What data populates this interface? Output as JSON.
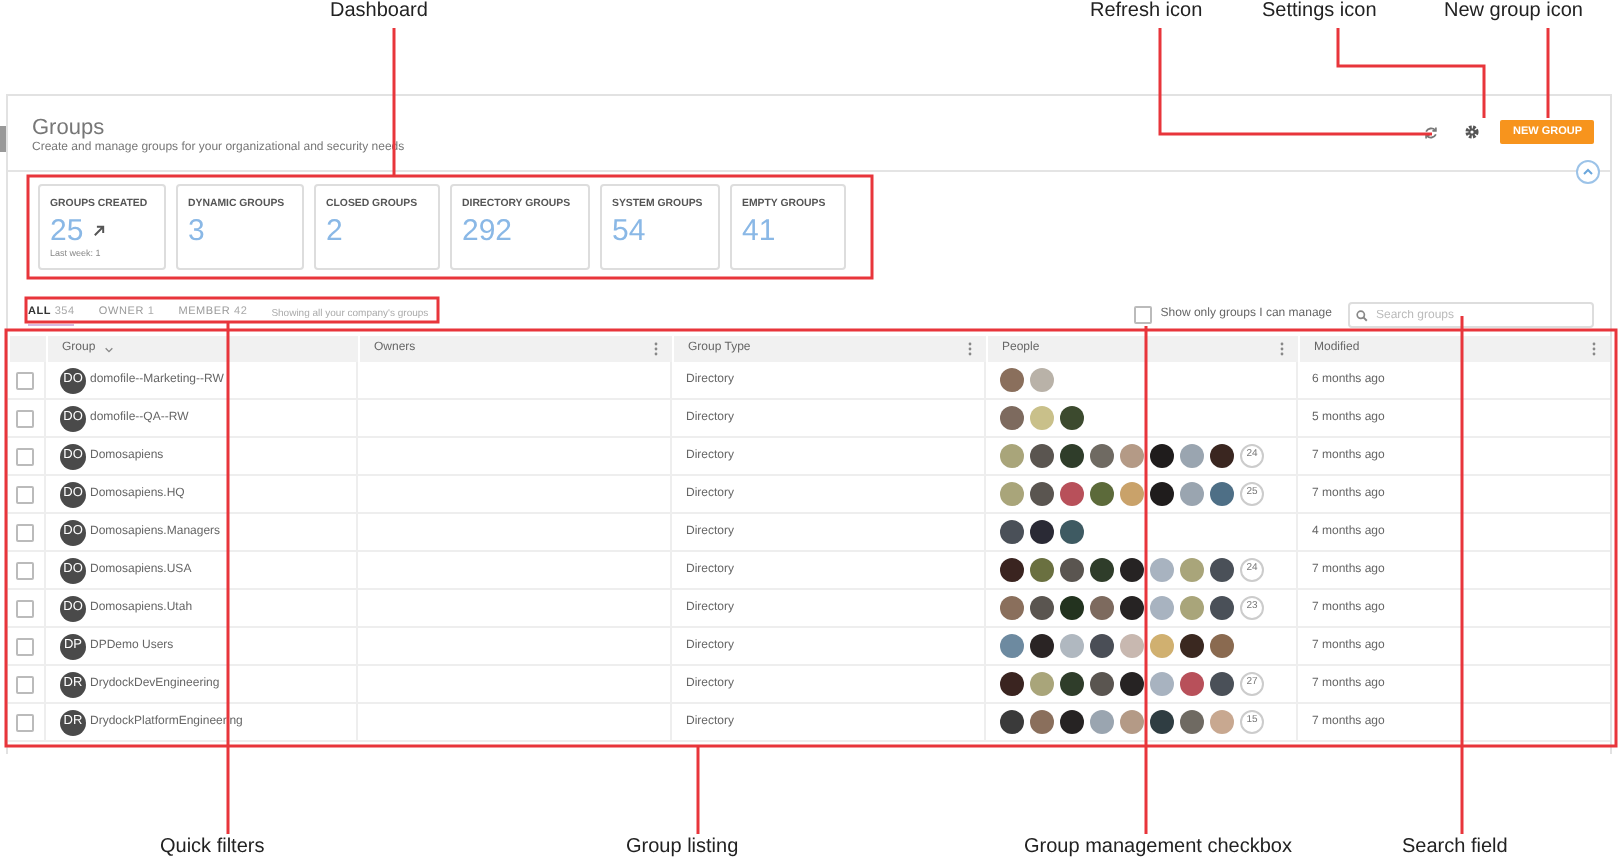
{
  "annotations": [
    {
      "label": "Dashboard"
    },
    {
      "label": "Refresh icon"
    },
    {
      "label": "Settings icon"
    },
    {
      "label": "New group icon"
    },
    {
      "label": "Quick filters"
    },
    {
      "label": "Group listing"
    },
    {
      "label": "Group management checkbox"
    },
    {
      "label": "Search field"
    }
  ],
  "header": {
    "title": "Groups",
    "subtitle": "Create and manage groups for your organizational and security needs",
    "new_button": "NEW GROUP"
  },
  "stats": [
    {
      "label": "GROUPS CREATED",
      "value": "25",
      "trend": true,
      "note": "Last week: 1"
    },
    {
      "label": "DYNAMIC GROUPS",
      "value": "3",
      "trend": false
    },
    {
      "label": "CLOSED GROUPS",
      "value": "2",
      "trend": false
    },
    {
      "label": "DIRECTORY GROUPS",
      "value": "292",
      "trend": false
    },
    {
      "label": "SYSTEM GROUPS",
      "value": "54",
      "trend": false
    },
    {
      "label": "EMPTY GROUPS",
      "value": "41",
      "trend": false
    }
  ],
  "filters": [
    {
      "label": "ALL",
      "count": "354",
      "selected": true
    },
    {
      "label": "OWNER",
      "count": "1",
      "selected": false
    },
    {
      "label": "MEMBER",
      "count": "42",
      "selected": false
    }
  ],
  "filter_note": "Showing all your company's groups",
  "manage_checkbox": {
    "label": "Show only groups I can manage",
    "checked": false
  },
  "search": {
    "placeholder": "Search groups"
  },
  "table": {
    "columns": [
      {
        "label": "Group",
        "kind": "sortable"
      },
      {
        "label": "Owners",
        "kind": "menu"
      },
      {
        "label": "Group Type",
        "kind": "menu"
      },
      {
        "label": "People",
        "kind": "menu"
      },
      {
        "label": "Modified",
        "kind": "menu"
      }
    ],
    "rows": [
      {
        "checked": false,
        "initials": "DO",
        "name": "domofile--Marketing--RW",
        "type": "Directory",
        "people": [
          {
            "color": "#8a6f5c"
          },
          {
            "color": "#b9b2a8"
          }
        ],
        "modified": "6 months ago"
      },
      {
        "checked": false,
        "initials": "DO",
        "name": "domofile--QA--RW",
        "type": "Directory",
        "people": [
          {
            "color": "#7d6a5e"
          },
          {
            "color": "#c9c08a"
          },
          {
            "color": "#3c4a2e"
          }
        ],
        "modified": "5 months ago"
      },
      {
        "checked": false,
        "initials": "DO",
        "name": "Domosapiens",
        "type": "Directory",
        "people": [
          {
            "color": "#a9a57a"
          },
          {
            "color": "#5a5550"
          },
          {
            "color": "#2f3d2a"
          },
          {
            "color": "#6f6a62"
          },
          {
            "color": "#b49a86"
          },
          {
            "color": "#1f1c1c"
          },
          {
            "color": "#9aa5b0"
          },
          {
            "color": "#3a2620"
          }
        ],
        "more": "24",
        "modified": "7 months ago"
      },
      {
        "checked": false,
        "initials": "DO",
        "name": "Domosapiens.HQ",
        "type": "Directory",
        "people": [
          {
            "color": "#a9a57a"
          },
          {
            "color": "#5a5550"
          },
          {
            "color": "#b8505a"
          },
          {
            "color": "#5c6a3a"
          },
          {
            "color": "#c9a26a"
          },
          {
            "color": "#1f1c1c"
          },
          {
            "color": "#9aa5b0"
          },
          {
            "color": "#4e6f86"
          }
        ],
        "more": "25",
        "modified": "7 months ago"
      },
      {
        "checked": false,
        "initials": "DO",
        "name": "Domosapiens.Managers",
        "type": "Directory",
        "people": [
          {
            "color": "#4a5058"
          },
          {
            "color": "#2a2a35"
          },
          {
            "color": "#3e5a62"
          }
        ],
        "modified": "4 months ago"
      },
      {
        "checked": false,
        "initials": "DO",
        "name": "Domosapiens.USA",
        "type": "Directory",
        "people": [
          {
            "color": "#3a2420"
          },
          {
            "color": "#6a7040"
          },
          {
            "color": "#5a5550"
          },
          {
            "color": "#2f3d2a"
          },
          {
            "color": "#262323"
          },
          {
            "color": "#a8b3c0"
          },
          {
            "color": "#a9a57a"
          },
          {
            "color": "#4a5058"
          }
        ],
        "more": "24",
        "modified": "7 months ago"
      },
      {
        "checked": false,
        "initials": "DO",
        "name": "Domosapiens.Utah",
        "type": "Directory",
        "people": [
          {
            "color": "#8a6f5c"
          },
          {
            "color": "#5a5550"
          },
          {
            "color": "#23331f"
          },
          {
            "color": "#7d6a5e"
          },
          {
            "color": "#262323"
          },
          {
            "color": "#a8b3c0"
          },
          {
            "color": "#a9a57a"
          },
          {
            "color": "#4a5058"
          }
        ],
        "more": "23",
        "modified": "7 months ago"
      },
      {
        "checked": false,
        "initials": "DP",
        "name": "DPDemo Users",
        "type": "Directory",
        "people": [
          {
            "color": "#6d8aa0"
          },
          {
            "color": "#2a2424"
          },
          {
            "color": "#b0b8c0"
          },
          {
            "color": "#4a4e56"
          },
          {
            "color": "#c8b8b0"
          },
          {
            "color": "#d0b070"
          },
          {
            "color": "#3a2820"
          },
          {
            "color": "#8a6a50"
          }
        ],
        "modified": "7 months ago"
      },
      {
        "checked": false,
        "initials": "DR",
        "name": "DrydockDevEngineering",
        "type": "Directory",
        "people": [
          {
            "color": "#3a2420"
          },
          {
            "color": "#a9a57a"
          },
          {
            "color": "#2f3d2a"
          },
          {
            "color": "#5a5550"
          },
          {
            "color": "#262323"
          },
          {
            "color": "#a8b3c0"
          },
          {
            "color": "#b8505a"
          },
          {
            "color": "#4a5058"
          }
        ],
        "more": "27",
        "modified": "7 months ago"
      },
      {
        "checked": false,
        "initials": "DR",
        "name": "DrydockPlatformEngineering",
        "type": "Directory",
        "people": [
          {
            "color": "#3a3a3a"
          },
          {
            "color": "#8a6f5c"
          },
          {
            "color": "#262323"
          },
          {
            "color": "#9aa5b0"
          },
          {
            "color": "#b49a86"
          },
          {
            "color": "#2f3d42"
          },
          {
            "color": "#6f6a62"
          },
          {
            "color": "#c8a890"
          }
        ],
        "more": "15",
        "modified": "7 months ago"
      }
    ]
  }
}
